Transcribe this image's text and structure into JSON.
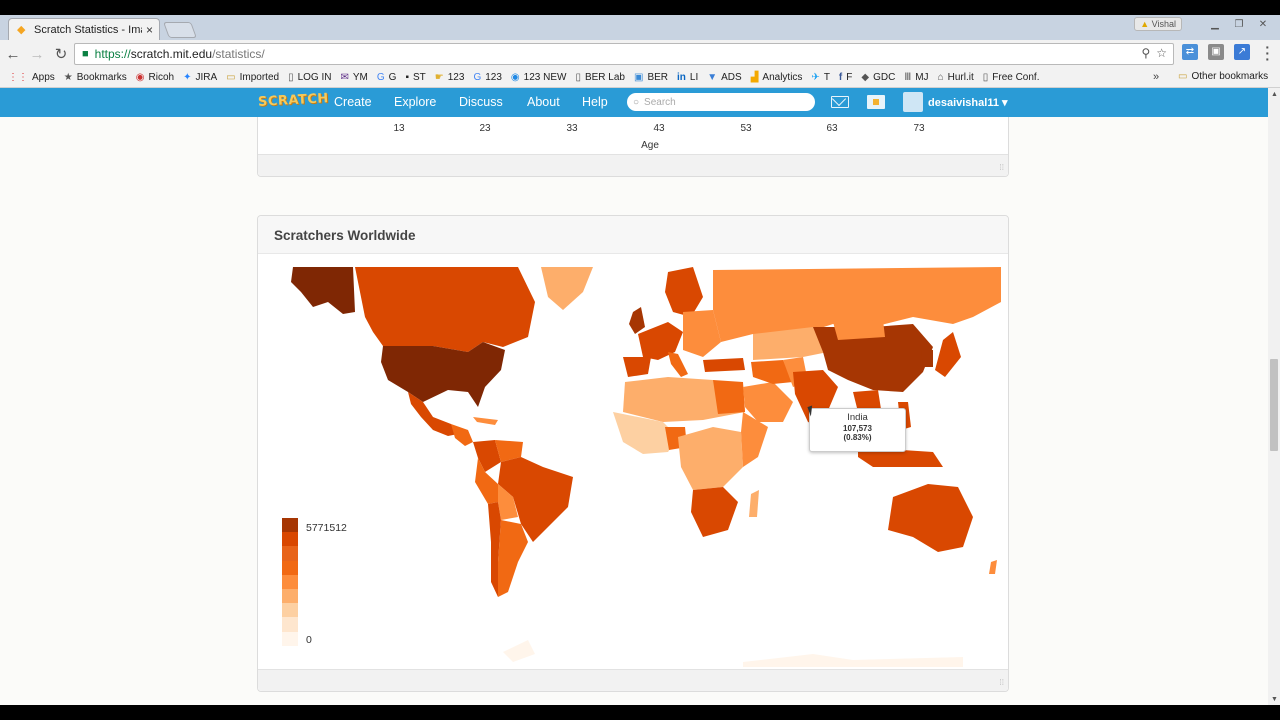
{
  "browser": {
    "tab_title": "Scratch Statistics - Imag",
    "tab_close": "×",
    "profile": "Vishal",
    "url_protocol": "https://",
    "url_host": "scratch.mit.edu",
    "url_path": "/statistics/"
  },
  "bookmarks": {
    "items": [
      {
        "label": "Apps",
        "icon": "apps-grid-icon"
      },
      {
        "label": "Bookmarks",
        "icon": "star-icon"
      },
      {
        "label": "Ricoh",
        "icon": "ricoh-icon"
      },
      {
        "label": "JIRA",
        "icon": "jira-icon"
      },
      {
        "label": "Imported",
        "icon": "folder-icon"
      },
      {
        "label": "LOG IN",
        "icon": "page-icon"
      },
      {
        "label": "YM",
        "icon": "mail-icon"
      },
      {
        "label": "G",
        "icon": "google-icon"
      },
      {
        "label": "ST",
        "icon": "st-icon"
      },
      {
        "label": "123",
        "icon": "folder-hand-icon"
      },
      {
        "label": "123",
        "icon": "google-icon"
      },
      {
        "label": "123 NEW",
        "icon": "globe-icon"
      },
      {
        "label": "BER Lab",
        "icon": "page-icon"
      },
      {
        "label": "BER",
        "icon": "image-icon"
      },
      {
        "label": "LI",
        "icon": "linkedin-icon"
      },
      {
        "label": "ADS",
        "icon": "bookmark-icon"
      },
      {
        "label": "Analytics",
        "icon": "analytics-icon"
      },
      {
        "label": "T",
        "icon": "twitter-icon"
      },
      {
        "label": "F",
        "icon": "facebook-icon"
      },
      {
        "label": "GDC",
        "icon": "gdc-icon"
      },
      {
        "label": "MJ",
        "icon": "mj-icon"
      },
      {
        "label": "Hurl.it",
        "icon": "hurl-icon"
      },
      {
        "label": "Free Conf.",
        "icon": "page-icon"
      }
    ],
    "more": "»",
    "other": "Other bookmarks"
  },
  "nav": {
    "logo": "SCRATCH",
    "create": "Create",
    "explore": "Explore",
    "discuss": "Discuss",
    "about": "About",
    "help": "Help",
    "search_placeholder": "Search",
    "username": "desaivishal11 ▾"
  },
  "age_chart": {
    "ticks": [
      "13",
      "23",
      "33",
      "43",
      "53",
      "63",
      "73"
    ],
    "xlabel": "Age"
  },
  "map_card": {
    "title": "Scratchers Worldwide",
    "legend_max": "5771512",
    "legend_min": "0",
    "tooltip": {
      "country": "India",
      "value": "107,573",
      "percent": "(0.83%)"
    }
  },
  "colors": {
    "nav": "#2a9bd6",
    "scale": [
      "#7f2704",
      "#a63603",
      "#d94801",
      "#f16913",
      "#fd8d3c",
      "#fdae6b",
      "#fdd0a2",
      "#fee6ce",
      "#fff5eb"
    ]
  }
}
